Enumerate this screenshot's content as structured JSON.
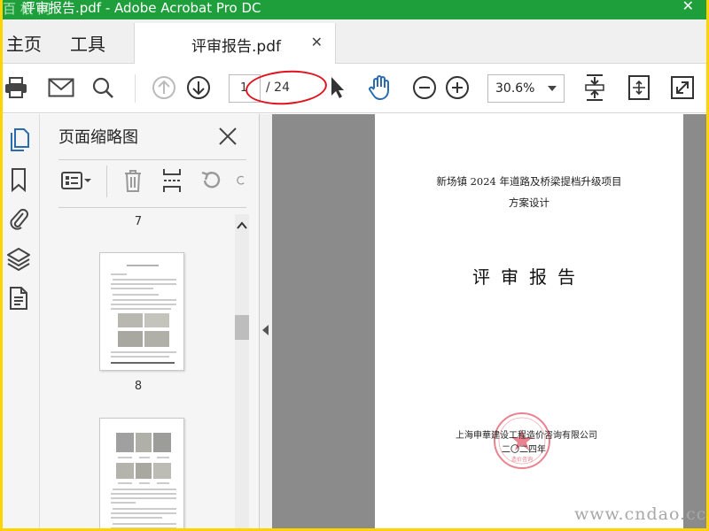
{
  "window": {
    "title": "评审报告.pdf - Adobe Acrobat Pro DC",
    "title_bar_color": "#1f9e3c"
  },
  "nav": {
    "home": "主页",
    "tools": "工具",
    "doc_tab": "评审报告.pdf"
  },
  "toolbar": {
    "page_current": "1",
    "page_total": "/ 24",
    "zoom": "30.6%",
    "icons": [
      "print-icon",
      "email-icon",
      "search-icon",
      "prev-page-icon",
      "next-page-icon",
      "select-cursor-icon",
      "hand-tool-icon",
      "zoom-out-icon",
      "zoom-in-icon",
      "fit-page-icon",
      "scroll-mode-icon",
      "fullscreen-icon"
    ]
  },
  "thumbnails_panel": {
    "title": "页面缩略图",
    "page_numbers": [
      "7",
      "8"
    ]
  },
  "document": {
    "heading_line1": "新场镇 2024 年道路及桥梁提档升级项目",
    "heading_line2": "方案设计",
    "main_title": "评审报告",
    "organization": "上海申華建设工程造价咨询有限公司",
    "date": "二〇二四年"
  },
  "highlight_color": "#e0141e",
  "accent_blue": "#2b6cb0"
}
